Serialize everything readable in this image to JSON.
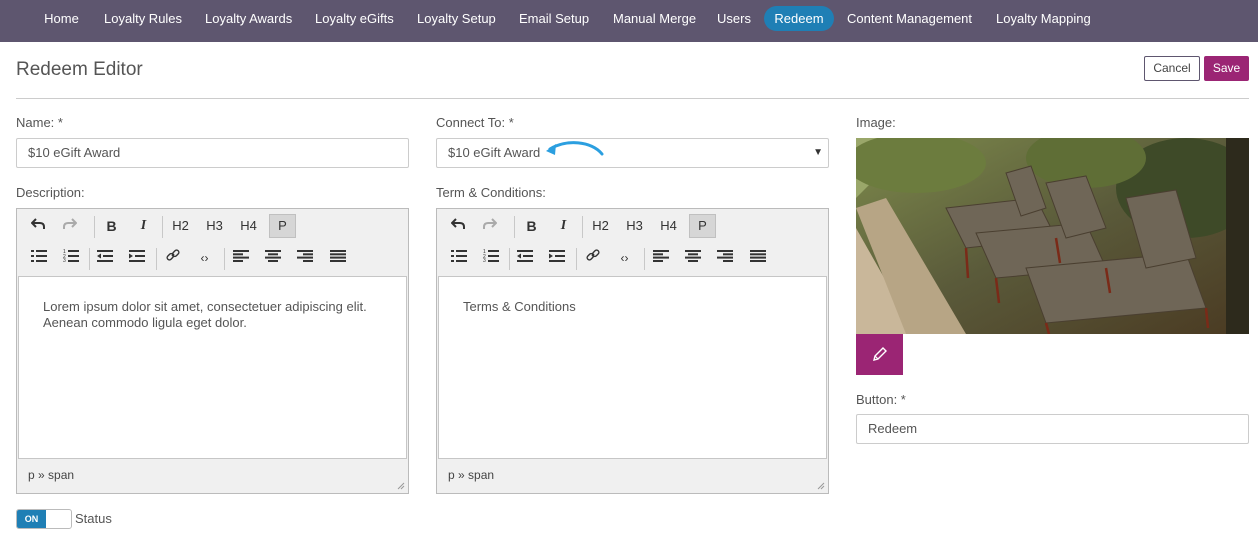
{
  "nav": {
    "items": [
      {
        "label": "Home"
      },
      {
        "label": "Loyalty Rules"
      },
      {
        "label": "Loyalty Awards"
      },
      {
        "label": "Loyalty eGifts"
      },
      {
        "label": "Loyalty Setup"
      },
      {
        "label": "Email Setup"
      },
      {
        "label": "Manual Merge"
      },
      {
        "label": "Users"
      },
      {
        "label": "Redeem"
      },
      {
        "label": "Content Management"
      },
      {
        "label": "Loyalty Mapping"
      }
    ],
    "active": "Redeem"
  },
  "header": {
    "title": "Redeem Editor",
    "cancel_label": "Cancel",
    "save_label": "Save"
  },
  "form": {
    "name_label": "Name: *",
    "name_value": "$10 eGift Award",
    "connect_label": "Connect To: *",
    "connect_value": "$10 eGift Award",
    "description_label": "Description:",
    "description_text_1": "Lorem ipsum dolor sit amet, consectetuer adipiscing elit.",
    "description_text_2": "Aenean commodo ligula eget dolor.",
    "terms_label": "Term & Conditions:",
    "terms_text": "Terms & Conditions",
    "image_label": "Image:",
    "button_label": "Button: *",
    "button_value": "Redeem",
    "status_label": "Status",
    "toggle_on": "ON"
  },
  "editor": {
    "heading_buttons": [
      "H2",
      "H3",
      "H4",
      "P"
    ],
    "statusbar": "p » span"
  },
  "colors": {
    "nav_bg": "#5e566f",
    "nav_active": "#1f7fb5",
    "save_bg": "#9b2574",
    "arrow": "#2b9fe0"
  }
}
